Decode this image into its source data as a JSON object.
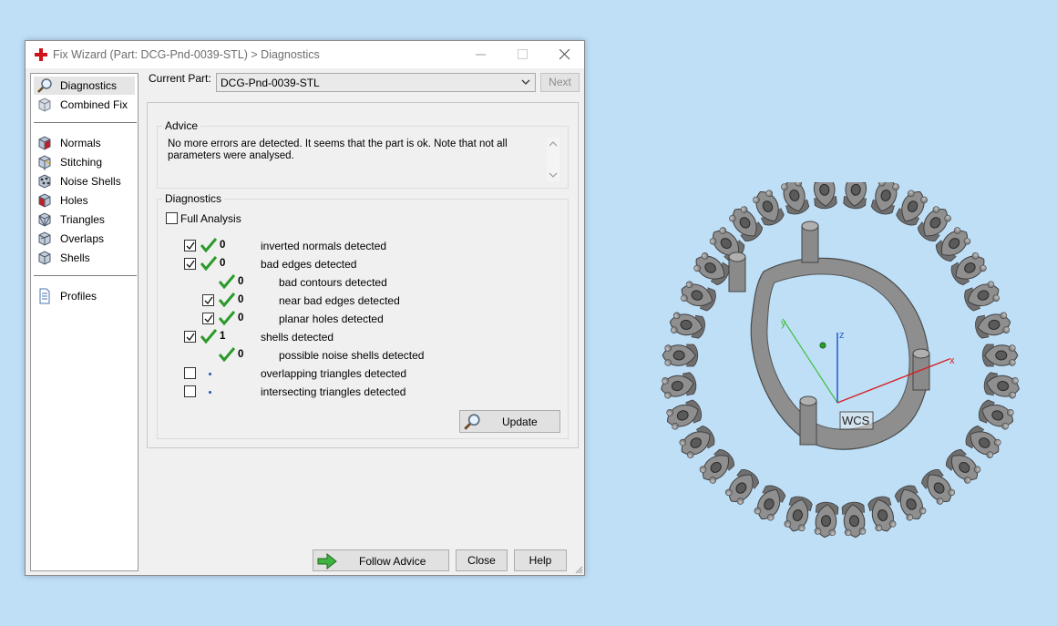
{
  "dialog": {
    "title": "Fix Wizard (Part: DCG-Pnd-0039-STL) > Diagnostics",
    "title_icon": "red-cross-icon"
  },
  "nav": {
    "items": [
      {
        "label": "Diagnostics",
        "icon": "magnifier-icon",
        "selected": true
      },
      {
        "label": "Combined Fix",
        "icon": "cube-icon"
      },
      {
        "label": "Normals",
        "icon": "normals-cube-icon"
      },
      {
        "label": "Stitching",
        "icon": "stitching-cube-icon"
      },
      {
        "label": "Noise Shells",
        "icon": "noise-shells-icon"
      },
      {
        "label": "Holes",
        "icon": "holes-cube-icon"
      },
      {
        "label": "Triangles",
        "icon": "triangles-cube-icon"
      },
      {
        "label": "Overlaps",
        "icon": "overlaps-cube-icon"
      },
      {
        "label": "Shells",
        "icon": "shells-cube-icon"
      },
      {
        "label": "Profiles",
        "icon": "document-icon"
      }
    ]
  },
  "header": {
    "current_part_label": "Current Part:",
    "current_part_value": "DCG-Pnd-0039-STL",
    "next_label": "Next"
  },
  "advice": {
    "title": "Advice",
    "text": "No more errors are detected. It seems that the part is ok. Note that not all parameters were analysed."
  },
  "diagnostics": {
    "title": "Diagnostics",
    "full_analysis_label": "Full Analysis",
    "full_analysis_checked": false,
    "rows": [
      {
        "checked": true,
        "status": "ok",
        "count": "0",
        "label": "inverted normals detected"
      },
      {
        "checked": true,
        "status": "ok",
        "count": "0",
        "label": "bad edges detected"
      },
      {
        "status": "ok",
        "count": "0",
        "label": "bad contours detected"
      },
      {
        "checked": true,
        "status": "ok",
        "count": "0",
        "label": "near bad edges detected"
      },
      {
        "checked": true,
        "status": "ok",
        "count": "0",
        "label": "planar holes detected"
      },
      {
        "checked": true,
        "status": "ok",
        "count": "1",
        "label": "shells detected"
      },
      {
        "status": "ok",
        "count": "0",
        "label": "possible noise shells detected"
      },
      {
        "checked": false,
        "status": "pending",
        "count": "",
        "label": "overlapping triangles detected"
      },
      {
        "checked": false,
        "status": "pending",
        "count": "",
        "label": "intersecting triangles detected"
      }
    ],
    "update_label": "Update"
  },
  "footer": {
    "follow_advice_label": "Follow Advice",
    "close_label": "Close",
    "help_label": "Help"
  },
  "viewport": {
    "wcs_label": "WCS",
    "axis_x": "x",
    "axis_y": "y",
    "axis_z": "z",
    "background_color": "#bfdff7",
    "part_color": "#9a9a9a",
    "x_axis_color": "#d42020",
    "y_axis_color": "#40c040",
    "z_axis_color": "#3060d0"
  },
  "colors": {
    "check_green": "#2a9a2a",
    "dialog_bg": "#f0f0f0"
  }
}
